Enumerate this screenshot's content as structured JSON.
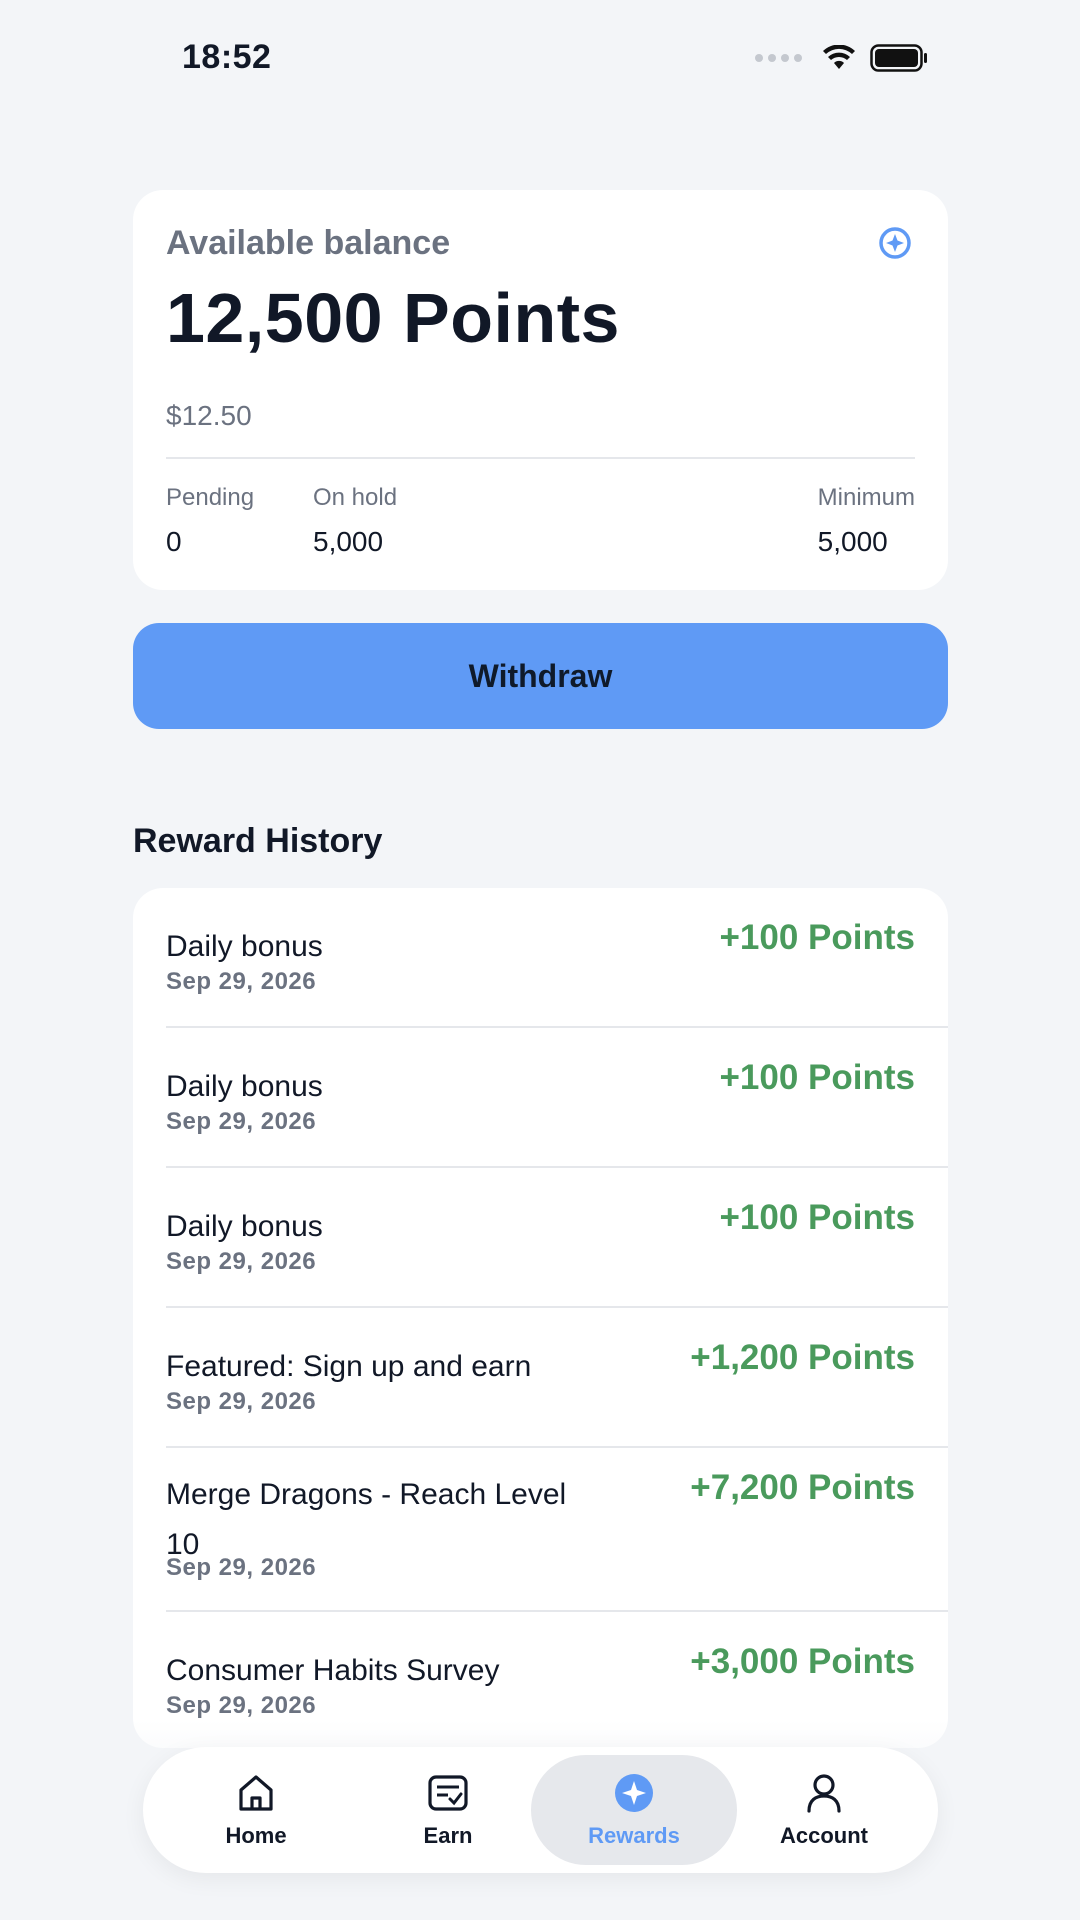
{
  "status_bar": {
    "time": "18:52",
    "icons": [
      "signal-icon",
      "wifi-icon",
      "battery-icon"
    ]
  },
  "balance": {
    "label": "Available balance",
    "amount": "12,500 Points",
    "usd": "$12.50",
    "icon": "sparkle-icon",
    "stats": [
      {
        "label": "Pending",
        "value": "0"
      },
      {
        "label": "On hold",
        "value": "5,000"
      },
      {
        "label": "Minimum",
        "value": "5,000"
      }
    ]
  },
  "withdraw_label": "Withdraw",
  "history": {
    "title": "Reward History",
    "items": [
      {
        "title": "Daily bonus",
        "date": "Sep 29, 2026",
        "amount": "+100 Points"
      },
      {
        "title": "Daily bonus",
        "date": "Sep 29, 2026",
        "amount": "+100 Points"
      },
      {
        "title": "Daily bonus",
        "date": "Sep 29, 2026",
        "amount": "+100 Points"
      },
      {
        "title": "Featured: Sign up and earn",
        "date": "Sep 29, 2026",
        "amount": "+1,200 Points"
      },
      {
        "title": "Merge Dragons - Reach Level 10",
        "date": "Sep 29, 2026",
        "amount": "+7,200 Points"
      },
      {
        "title": "Consumer Habits Survey",
        "date": "Sep 29, 2026",
        "amount": "+3,000 Points"
      }
    ]
  },
  "nav": {
    "items": [
      {
        "label": "Home",
        "icon": "home-icon"
      },
      {
        "label": "Earn",
        "icon": "earn-icon"
      },
      {
        "label": "Rewards",
        "icon": "rewards-icon"
      },
      {
        "label": "Account",
        "icon": "account-icon"
      }
    ],
    "active": "Rewards"
  },
  "colors": {
    "accent": "#5f9af5",
    "positive": "#4a9a5c",
    "background": "#f3f5f8"
  }
}
